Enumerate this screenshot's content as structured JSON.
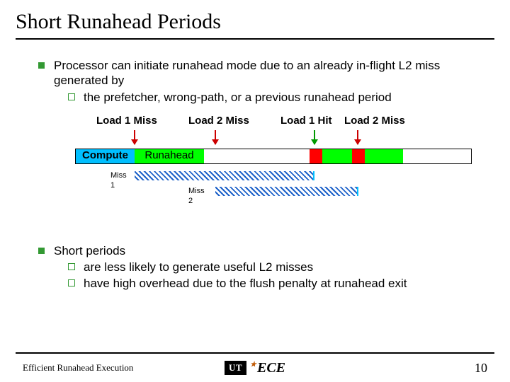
{
  "title": "Short Runahead Periods",
  "bullets": {
    "b1": "Processor can initiate runahead mode due to an already in-flight L2 miss generated by",
    "b1_1": "the prefetcher, wrong-path, or a previous runahead period",
    "b2": "Short periods",
    "b2_1": "are less likely to generate useful L2 misses",
    "b2_2": "have high overhead due to the flush penalty at runahead exit"
  },
  "timeline": {
    "labels": {
      "l1": "Load 1 Miss",
      "l2": "Load 2 Miss",
      "l3": "Load 1 Hit",
      "l4": "Load 2 Miss"
    },
    "segs": {
      "compute": "Compute",
      "run": "Runahead"
    },
    "miss1": "Miss 1",
    "miss2": "Miss 2"
  },
  "footer": {
    "left": "Efficient Runahead Execution",
    "logo_ut": "UT",
    "logo_ece": "ECE",
    "page": "10"
  }
}
